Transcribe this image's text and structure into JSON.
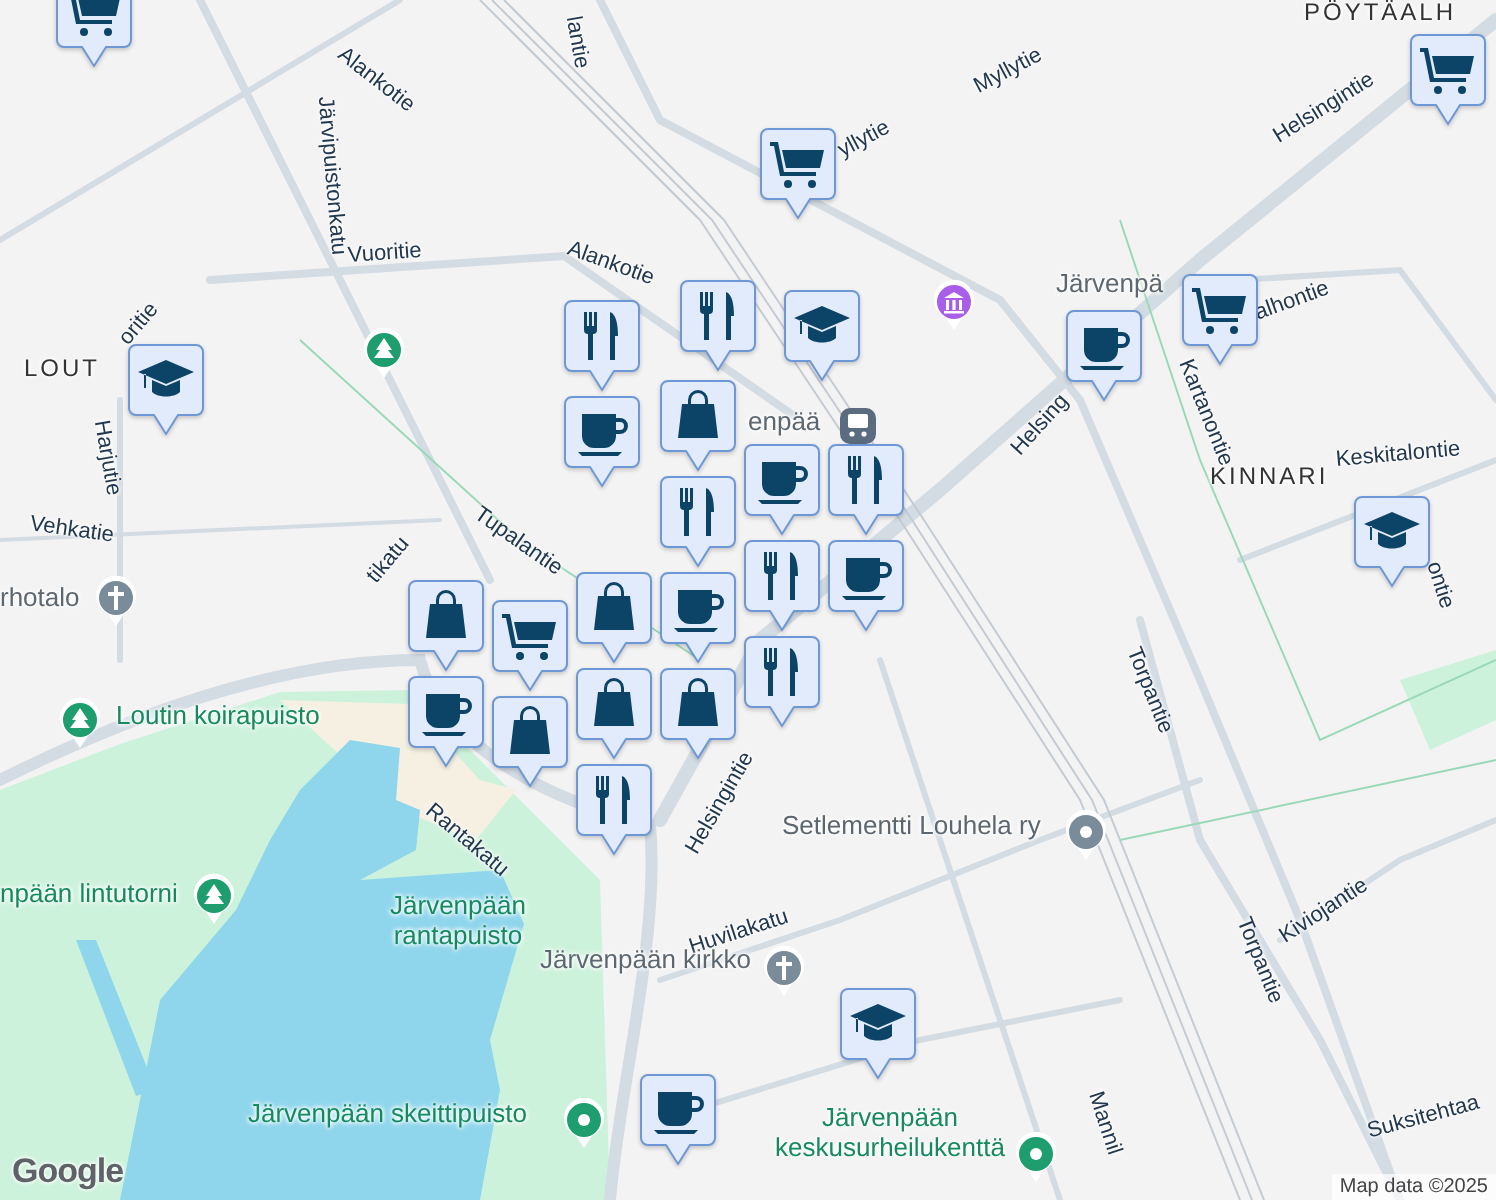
{
  "map": {
    "labels": [
      {
        "kind": "street",
        "text": "lantie"
      },
      {
        "kind": "street",
        "text": "Alankotie"
      },
      {
        "kind": "street",
        "text": "Järvipuistonkatu"
      },
      {
        "kind": "street",
        "text": "Vuoritie"
      },
      {
        "kind": "street",
        "text": "Alankotie"
      },
      {
        "kind": "street",
        "text": "oritie"
      },
      {
        "kind": "street",
        "text": "Harjutie"
      },
      {
        "kind": "street",
        "text": "Vehkatie"
      },
      {
        "kind": "street",
        "text": "Tupalantie"
      },
      {
        "kind": "street",
        "text": "tikatu"
      },
      {
        "kind": "street",
        "text": "Rantakatu"
      },
      {
        "kind": "street",
        "text": "Helsingintie"
      },
      {
        "kind": "street",
        "text": "Huvilakatu"
      },
      {
        "kind": "street",
        "text": "yllytie"
      },
      {
        "kind": "street",
        "text": "Myllytie"
      },
      {
        "kind": "street",
        "text": "Helsingintie"
      },
      {
        "kind": "street",
        "text": "Helsing"
      },
      {
        "kind": "street",
        "text": "Kartanontie"
      },
      {
        "kind": "street",
        "text": "alhontie"
      },
      {
        "kind": "street",
        "text": "Keskitalontie"
      },
      {
        "kind": "street",
        "text": "Torpantie"
      },
      {
        "kind": "street",
        "text": "Torpantie"
      },
      {
        "kind": "street",
        "text": "Kiviojantie"
      },
      {
        "kind": "street",
        "text": "Suksitehtaa"
      },
      {
        "kind": "street",
        "text": "Mannil"
      },
      {
        "kind": "street",
        "text": "ontie"
      },
      {
        "kind": "district",
        "text": "LOUT"
      },
      {
        "kind": "district",
        "text": "PÖYTÄALH"
      },
      {
        "kind": "district",
        "text": "KINNARI"
      },
      {
        "kind": "place",
        "text": "Järvenpä"
      },
      {
        "kind": "place",
        "text": "enpää"
      },
      {
        "kind": "place",
        "text": "rhotalo"
      },
      {
        "kind": "place",
        "text": "Setlementti Louhela ry"
      },
      {
        "kind": "place",
        "text": "Järvenpään kirkko"
      },
      {
        "kind": "park",
        "text": "Loutin koirapuisto"
      },
      {
        "kind": "park",
        "text": "npään lintutorni"
      },
      {
        "kind": "park",
        "text": "Järvenpään rantapuisto"
      },
      {
        "kind": "park",
        "text": "Järvenpään skeittipuisto"
      },
      {
        "kind": "park",
        "text": "Järvenpään keskusurheilukenttä"
      }
    ],
    "pins": [
      {
        "kind": "tree"
      },
      {
        "kind": "museum"
      },
      {
        "kind": "train"
      },
      {
        "kind": "church"
      },
      {
        "kind": "tree"
      },
      {
        "kind": "tree"
      },
      {
        "kind": "church"
      },
      {
        "kind": "place"
      },
      {
        "kind": "sport"
      },
      {
        "kind": "sport"
      }
    ],
    "markers": [
      {
        "kind": "cart"
      },
      {
        "kind": "cart"
      },
      {
        "kind": "cart"
      },
      {
        "kind": "cart"
      },
      {
        "kind": "school"
      },
      {
        "kind": "school"
      },
      {
        "kind": "school"
      },
      {
        "kind": "school"
      },
      {
        "kind": "cup"
      },
      {
        "kind": "cup"
      },
      {
        "kind": "cutlery"
      },
      {
        "kind": "cutlery"
      },
      {
        "kind": "cup"
      },
      {
        "kind": "bag"
      },
      {
        "kind": "cutlery"
      },
      {
        "kind": "cup"
      },
      {
        "kind": "cutlery"
      },
      {
        "kind": "cutlery"
      },
      {
        "kind": "cup"
      },
      {
        "kind": "cup"
      },
      {
        "kind": "bag"
      },
      {
        "kind": "bag"
      },
      {
        "kind": "bag"
      },
      {
        "kind": "cutlery"
      },
      {
        "kind": "cart"
      },
      {
        "kind": "bag"
      },
      {
        "kind": "cup"
      },
      {
        "kind": "bag"
      },
      {
        "kind": "cutlery"
      }
    ]
  },
  "attribution": {
    "logo": "Google",
    "text": "Map data ©2025"
  }
}
